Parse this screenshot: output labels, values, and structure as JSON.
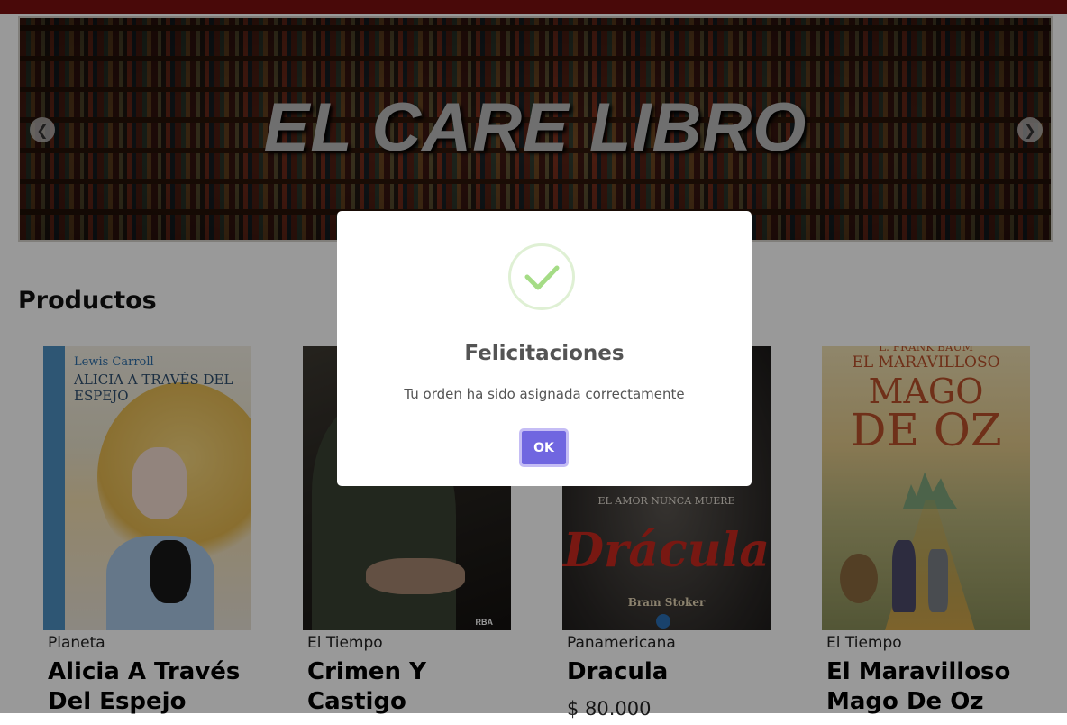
{
  "hero": {
    "title": "EL CARE LIBRO"
  },
  "section_title": "Productos",
  "products": [
    {
      "publisher": "Planeta",
      "title": "Alicia A Través Del Espejo",
      "cover_author": "Lewis Carroll",
      "cover_title": "ALICIA A TRAVÉS DEL ESPEJO"
    },
    {
      "publisher": "El Tiempo",
      "title": "Crimen Y Castigo",
      "cover_logo": "RBA"
    },
    {
      "publisher": "Panamericana",
      "title": "Dracula",
      "price": "$ 80.000",
      "cover_tagline": "EL AMOR NUNCA MUERE",
      "cover_title": "Drácula",
      "cover_author": "Bram Stoker"
    },
    {
      "publisher": "El Tiempo",
      "title": "El Maravilloso Mago De Oz",
      "cover_author": "L. FRANK BAUM",
      "cover_title_line1": "EL MARAVILLOSO",
      "cover_title_line2": "MAGO",
      "cover_title_line3": "DE OZ"
    }
  ],
  "modal": {
    "title": "Felicitaciones",
    "message": "Tu orden ha sido asignada correctamente",
    "confirm_label": "OK",
    "icon": "success-check-icon",
    "accent_color": "#7066e0",
    "icon_color": "#a5dc86"
  }
}
